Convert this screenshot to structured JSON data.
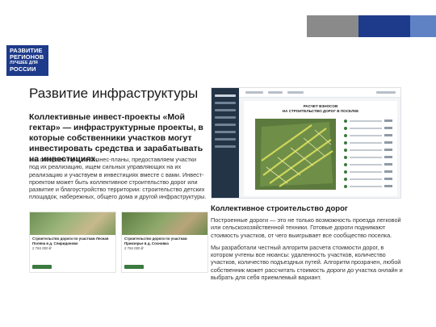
{
  "logo": {
    "line1": "РАЗВИТИЕ",
    "line2": "РЕГИОНОВ",
    "line3": "ЛУЧШЕЕ ДЛЯ",
    "line4": "РОССИИ"
  },
  "page_title": "Развитие инфраструктуры",
  "left": {
    "lead": "Коллективные инвест-проекты «Мой гектар» — инфраструктурные проекты, в которые собственники участков могут инвестировать средства и зарабатывать на инвестициях.",
    "body": "Мы отбираем лучшие бизнес-планы, предоставляем участки под их реализацию, ищем сильных управляющих на их реализацию и участвуем в инвестициях вместе с вами. Инвест-проектом может быть коллективное строительство дорог или развитие и благоустройство территории: строительство детских площадок, набережных, общего дома и другой инфраструктуры.",
    "cards": [
      {
        "title": "Строительство дороги по участкам Лесная Поляна в д. Спиридоново",
        "price": "2 784 000 ₽"
      },
      {
        "title": "Строительство дороги по участкам Приозерье в д. Сосновка",
        "price": "2 784 000 ₽"
      }
    ]
  },
  "screenshot": {
    "title_line1": "РАСЧЕТ ВЗНОСОВ",
    "title_line2": "НА СТРОИТЕЛЬСТВО ДОРОГ В ПОСЕЛКЕ"
  },
  "right": {
    "subtitle": "Коллективное строительство дорог",
    "para1": "Построенные дороги — это не только возможность проезда легковой или сельскохозяйственной техники. Готовые дороги поднимают стоимость участков, от чего выигрывает все сообщество поселка.",
    "para2": "Мы разработали честный алгоритм расчета стоимости дорог, в котором учтены все нюансы: удаленность участков, количество участков, количество подъездных путей. Алгоритм прозрачен, любой собственник может рассчитать стоимость дороги до участка онлайн и выбрать для себя приемлемый вариант."
  },
  "colors": {
    "brand_blue": "#1e3a8a",
    "accent_blue": "#5f82c5",
    "accent_gray": "#8a8a8a",
    "green": "#3b7a3f"
  }
}
